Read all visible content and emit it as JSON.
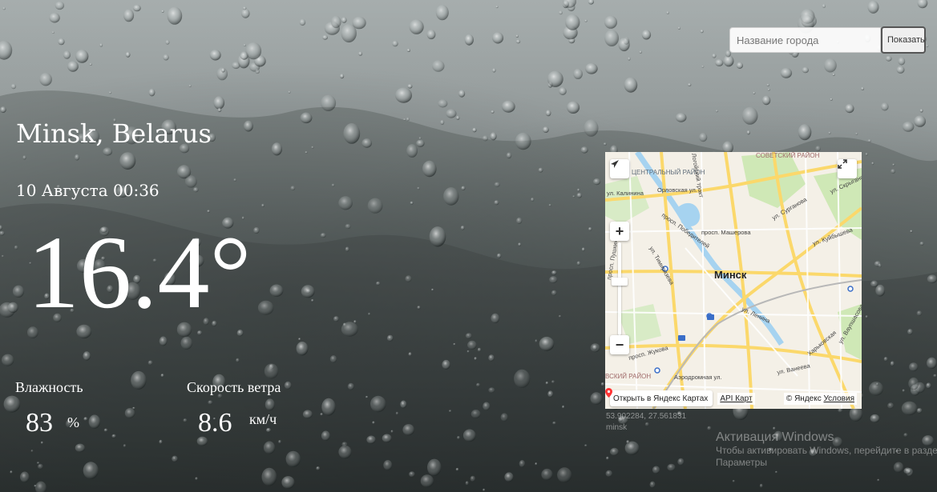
{
  "search": {
    "placeholder": "Название города",
    "button_label": "Показать"
  },
  "location": {
    "city": "Minsk, Belarus",
    "datetime": "10 Августа 00:36"
  },
  "current": {
    "temperature": "16.4°"
  },
  "stats": {
    "humidity_label": "Влажность",
    "humidity_value": "83",
    "humidity_unit": "%",
    "wind_label": "Скорость ветра",
    "wind_value": "8.6",
    "wind_unit": "км/ч"
  },
  "map": {
    "center_label": "Минск",
    "labels": {
      "district_central": "ЦЕНТРАЛЬНЫЙ РАЙОН",
      "district_soviet": "СОВЕТСКИЙ РАЙОН",
      "street_orlovskaya": "Орловская ул.",
      "street_pobediteley": "просп. Победителей",
      "street_masherova": "просп. Машерова",
      "street_surganova": "ул. Сурганова",
      "street_pushkina": "просп. Пушкина",
      "street_timiryazeva": "ул. Тимирязева",
      "street_lenina": "ул. Ленина",
      "street_zhukova": "просп. Жукова",
      "street_aerodromnaya": "Аэродромная ул.",
      "street_vaneeva": "ул. Ванеева",
      "street_kuybysheva": "ул. Куйбышева",
      "street_kalinina": "ул. Калинина",
      "street_skryganova": "ул. Скрыганова",
      "street_gintovta": "ул. Ваупшасова",
      "district_mosk": "ВСКИЙ РАЙОН",
      "street_kharkovskaya": "Харьковская",
      "tract": "Логойский тракт"
    },
    "open_label": "Открыть в Яндекс Картах",
    "api_label": "API Карт",
    "copyright": "© Яндекс",
    "terms": "Условия",
    "zoom_in": "+",
    "zoom_out": "−"
  },
  "coords": {
    "line1": "53.902284, 27.561831",
    "line2": "minsk"
  },
  "watermark": {
    "title": "Активация Windows",
    "line1": "Чтобы активировать Windows, перейдите в раздел",
    "line2": "Параметры"
  }
}
